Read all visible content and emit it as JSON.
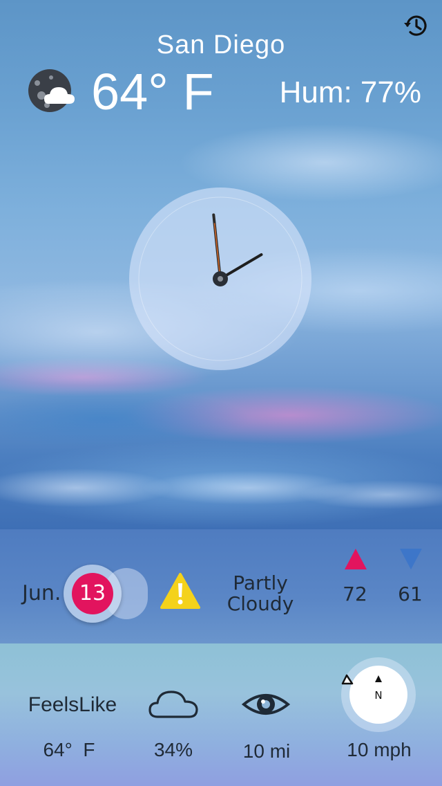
{
  "header": {
    "city": "San Diego",
    "temperature": "64°  F",
    "humidity": "Hum: 77%",
    "weather_icon": "partly-cloudy-night-icon",
    "history_icon": "history-icon"
  },
  "clock": {
    "hour": 1,
    "minute": 59
  },
  "today": {
    "month": "Jun.",
    "day": "13",
    "alert_icon": "warning-icon",
    "condition_line1": "Partly",
    "condition_line2": "Cloudy",
    "high": "72",
    "low": "61"
  },
  "details": {
    "feels_label": "FeelsLike",
    "feels_value": "64°  F",
    "cloud_cover": "34%",
    "visibility": "10 mi",
    "compass_label": "N",
    "wind_speed": "10 mph"
  },
  "colors": {
    "accent": "#e2145e",
    "low_arrow": "#3d76c9",
    "alert": "#f4d21b"
  }
}
